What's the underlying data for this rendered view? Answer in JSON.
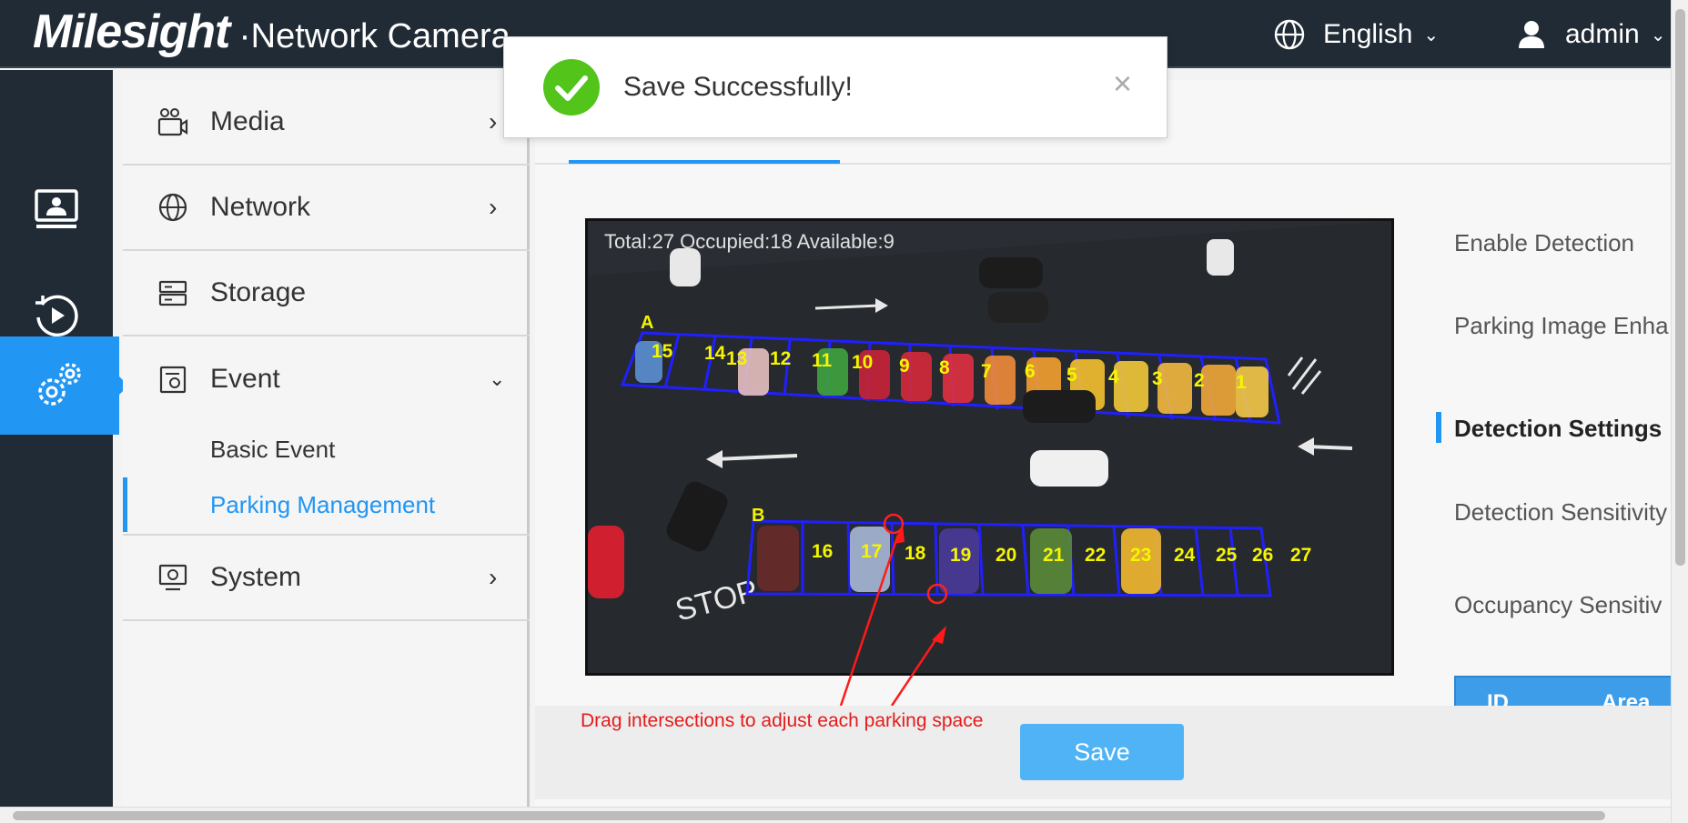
{
  "header": {
    "brand": "Milesight",
    "separator": "·",
    "product": "Network Camera",
    "language": "English",
    "user": "admin"
  },
  "rail": {
    "items": [
      {
        "name": "live-view",
        "icon": "monitor-icon"
      },
      {
        "name": "playback",
        "icon": "playback-icon"
      },
      {
        "name": "settings",
        "icon": "gears-icon",
        "active": true
      }
    ]
  },
  "menu": {
    "items": [
      {
        "label": "Media",
        "chevron": "›"
      },
      {
        "label": "Network",
        "chevron": "›"
      },
      {
        "label": "Storage",
        "chevron": ""
      },
      {
        "label": "Event",
        "chevron": "⌄"
      },
      {
        "label": "System",
        "chevron": "›"
      }
    ],
    "event_sub": [
      {
        "label": "Basic Event"
      },
      {
        "label": "Parking Management",
        "active": true
      }
    ]
  },
  "video": {
    "overlay": "Total:27 Occupied:18 Available:9",
    "area_a": "A",
    "area_b": "B"
  },
  "settings": {
    "enable_detection": "Enable Detection",
    "parking_image": "Parking Image Enha",
    "detection_settings": "Detection Settings",
    "detection_sensitivity": "Detection Sensitivity",
    "occupancy_sensitivity": "Occupancy Sensitiv",
    "table_id": "ID",
    "table_area": "Area N"
  },
  "annotation": "Drag intersections to adjust each parking space",
  "save_label": "Save",
  "toast": {
    "message": "Save Successfully!",
    "close": "×"
  },
  "colors": {
    "accent": "#2196f3",
    "header_bg": "#212b35",
    "success": "#52c41a",
    "annotation": "#e41b1b"
  }
}
